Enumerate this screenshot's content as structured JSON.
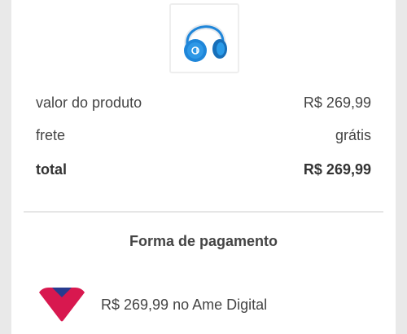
{
  "product": {
    "image_icon": "headphones-icon",
    "image_color": "#1f86d9"
  },
  "summary": {
    "product_value_label": "valor do produto",
    "product_value": "R$ 269,99",
    "shipping_label": "frete",
    "shipping_value": "grátis",
    "total_label": "total",
    "total_value": "R$ 269,99"
  },
  "payment": {
    "section_title": "Forma de pagamento",
    "method_icon": "ame-digital-logo",
    "method_text": "R$ 269,99 no Ame Digital",
    "colors": {
      "ame_pink": "#d8184f",
      "ame_navy": "#283b8f"
    }
  }
}
